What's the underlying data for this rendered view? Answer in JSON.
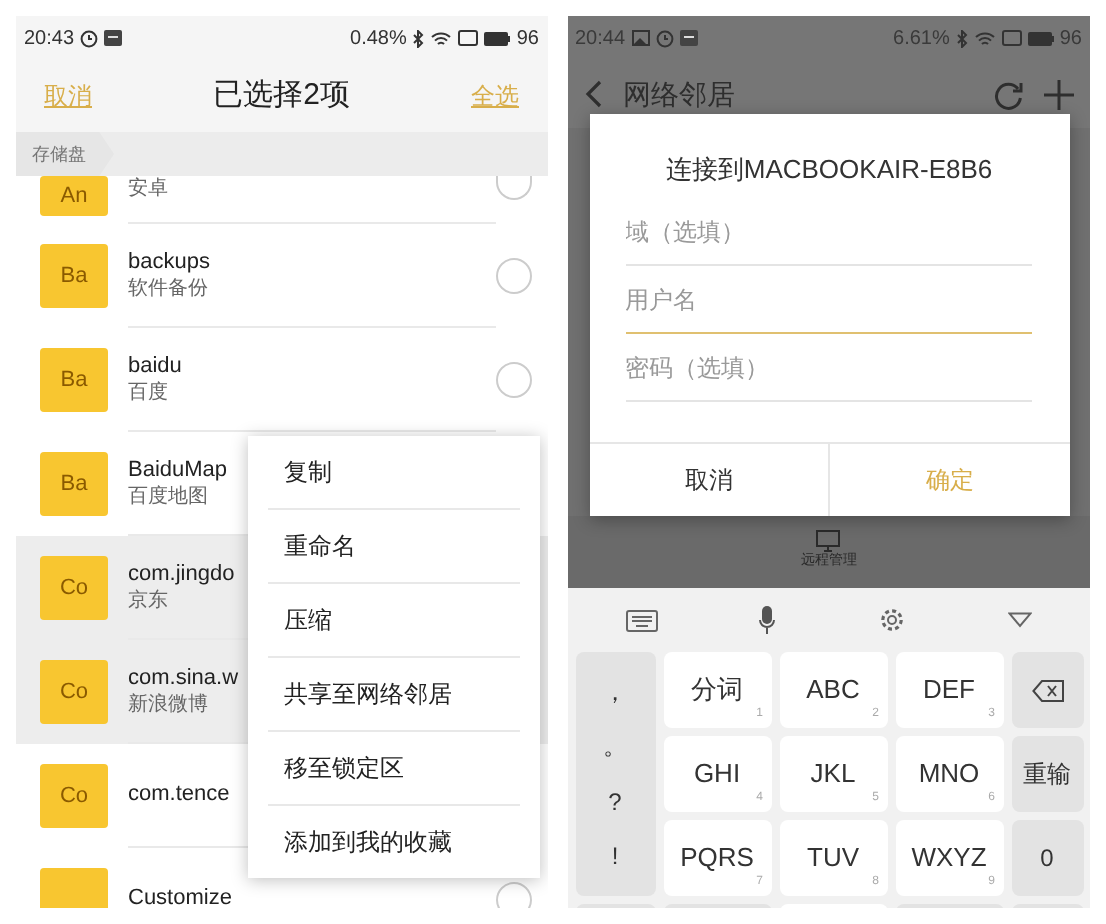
{
  "left_screen": {
    "status_bar": {
      "time": "20:43",
      "speed": "0.48%",
      "battery": "96"
    },
    "header": {
      "cancel": "取消",
      "title": "已选择2项",
      "select_all": "全选"
    },
    "breadcrumb": "存储盘",
    "folders": [
      {
        "kind": "partial",
        "icon_label": "An",
        "subtitle": "安卓",
        "selected": false
      },
      {
        "kind": "full",
        "icon_label": "Ba",
        "name": "backups",
        "subtitle": "软件备份",
        "selected": false
      },
      {
        "kind": "full",
        "icon_label": "Ba",
        "name": "baidu",
        "subtitle": "百度",
        "selected": false
      },
      {
        "kind": "full",
        "icon_label": "Ba",
        "name": "BaiduMap",
        "subtitle": "百度地图",
        "selected": false
      },
      {
        "kind": "full",
        "icon_label": "Co",
        "name": "com.jingdo",
        "subtitle": "京东",
        "selected": true
      },
      {
        "kind": "full",
        "icon_label": "Co",
        "name": "com.sina.w",
        "subtitle": "新浪微博",
        "selected": true
      },
      {
        "kind": "full",
        "icon_label": "Co",
        "name": "com.tence",
        "selected": false
      },
      {
        "kind": "full",
        "name": "Customize",
        "selected": false
      }
    ],
    "context_menu": [
      "复制",
      "重命名",
      "压缩",
      "共享至网络邻居",
      "移至锁定区",
      "添加到我的收藏"
    ]
  },
  "right_screen": {
    "status_bar": {
      "time": "20:44",
      "speed": "6.61%",
      "battery": "96"
    },
    "header": {
      "title": "网络邻居"
    },
    "dialog": {
      "title": "连接到MACBOOKAIR-E8B6",
      "fields": [
        {
          "placeholder": "域（选填）",
          "focused": false
        },
        {
          "placeholder": "用户名",
          "focused": true
        },
        {
          "placeholder": "密码（选填）",
          "focused": false
        }
      ],
      "buttons": [
        {
          "label": "取消",
          "kind": "cancel"
        },
        {
          "label": "确定",
          "kind": "confirm"
        }
      ]
    },
    "bottom_tab": {
      "label": "远程管理"
    },
    "keyboard": {
      "punctuation": [
        "，",
        "。",
        "?",
        "!"
      ],
      "keys": [
        {
          "label": "分词",
          "digit": "1"
        },
        {
          "label": "ABC",
          "digit": "2"
        },
        {
          "label": "DEF",
          "digit": "3"
        },
        {
          "label": "GHI",
          "digit": "4"
        },
        {
          "label": "JKL",
          "digit": "5"
        },
        {
          "label": "MNO",
          "digit": "6"
        },
        {
          "label": "PQRS",
          "digit": "7"
        },
        {
          "label": "TUV",
          "digit": "8"
        },
        {
          "label": "WXYZ",
          "digit": "9"
        }
      ],
      "side_keys": [
        {
          "kind": "backspace"
        },
        {
          "kind": "text",
          "label": "重输"
        },
        {
          "kind": "text",
          "label": "0"
        }
      ]
    }
  }
}
